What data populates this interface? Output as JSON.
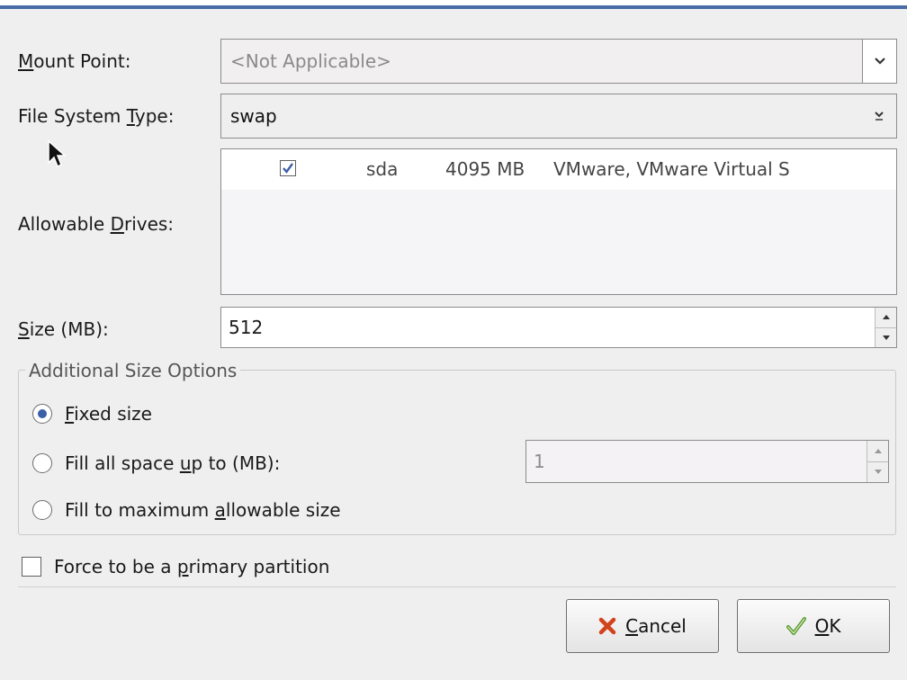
{
  "dialog": {
    "mount_point": {
      "label_mnemonic": "M",
      "label_rest": "ount Point:",
      "value": "<Not Applicable>"
    },
    "fs_type": {
      "label_before": "File System ",
      "label_mnemonic": "T",
      "label_after": "ype:",
      "value": "swap"
    },
    "drives": {
      "label_before": "Allowable ",
      "label_mnemonic": "D",
      "label_after": "rives:",
      "rows": [
        {
          "checked": true,
          "name": "sda",
          "size": "4095 MB",
          "model": "VMware, VMware Virtual S"
        }
      ]
    },
    "size": {
      "label_mnemonic": "S",
      "label_rest": "ize (MB):",
      "value": "512"
    },
    "options": {
      "title": "Additional Size Options",
      "fixed": {
        "mnemonic": "F",
        "rest": "ixed size",
        "selected": true
      },
      "fill_upto": {
        "before": "Fill all space ",
        "mnemonic": "u",
        "after": "p to (MB):",
        "selected": false,
        "value": "1"
      },
      "fill_max": {
        "before": "Fill to maximum ",
        "mnemonic": "a",
        "after": "llowable size",
        "selected": false
      }
    },
    "primary": {
      "before": "Force to be a ",
      "mnemonic": "p",
      "after": "rimary partition",
      "checked": false
    },
    "buttons": {
      "cancel": {
        "mnemonic": "C",
        "rest": "ancel"
      },
      "ok": {
        "mnemonic": "O",
        "rest": "K"
      }
    }
  },
  "colors": {
    "title_bar_accent": "#4a6da7",
    "radio_selected": "#3b5ea8",
    "checkmark": "#3b5ea8",
    "cancel_icon": "#d2421c",
    "ok_icon": "#5a9a2e"
  },
  "icons": {
    "combo_arrow": "chevron-down-icon",
    "checkmark": "check-icon",
    "spin_up": "arrow-up-icon",
    "spin_down": "arrow-down-icon",
    "cancel": "x-icon",
    "ok": "check-icon",
    "cursor": "mouse-pointer-icon"
  }
}
